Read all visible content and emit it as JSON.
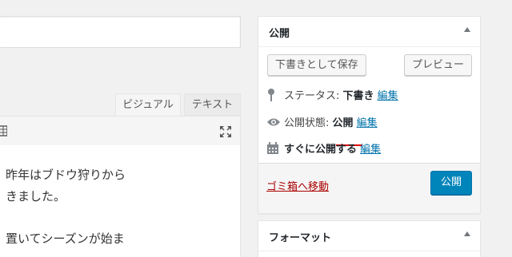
{
  "editor": {
    "tabs": {
      "visual": "ビジュアル",
      "text": "テキスト"
    },
    "content_lines": [
      "昨年はブドウ狩りから",
      "きました。",
      "置いてシーズンが始ま"
    ]
  },
  "publish_box": {
    "title": "公開",
    "save_draft": "下書きとして保存",
    "preview": "プレビュー",
    "status_label": "ステータス: ",
    "status_value": "下書き",
    "visibility_label": "公開状態: ",
    "visibility_value": "公開",
    "schedule_label": "すぐに公開する",
    "edit_link": "編集",
    "trash": "ゴミ箱へ移動",
    "publish": "公開"
  },
  "format_box": {
    "title": "フォーマット"
  }
}
